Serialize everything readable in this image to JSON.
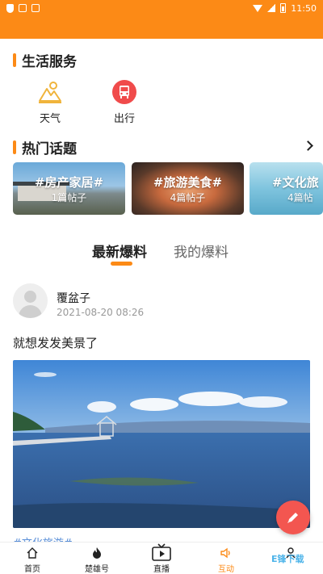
{
  "status_bar": {
    "time": "11:50"
  },
  "life_services": {
    "title": "生活服务",
    "items": [
      {
        "label": "天气",
        "icon": "weather-mountain-icon"
      },
      {
        "label": "出行",
        "icon": "bus-icon"
      }
    ]
  },
  "hot_topics": {
    "title": "热门话题",
    "cards": [
      {
        "title": "#房产家居#",
        "count": "1篇帖子"
      },
      {
        "title": "#旅游美食#",
        "count": "4篇帖子"
      },
      {
        "title": "#文化旅",
        "count": "4篇帖"
      }
    ]
  },
  "tabs": [
    {
      "label": "最新爆料",
      "active": true
    },
    {
      "label": "我的爆料",
      "active": false
    }
  ],
  "post": {
    "author": "覆盆子",
    "time": "2021-08-20 08:26",
    "content": "就想发发美景了",
    "hashtag": "#文化旅游#"
  },
  "bottom_nav": [
    {
      "label": "首页",
      "icon": "home-icon",
      "active": false
    },
    {
      "label": "楚雄号",
      "icon": "flame-icon",
      "active": false
    },
    {
      "label": "直播",
      "icon": "tv-play-icon",
      "active": false
    },
    {
      "label": "互动",
      "icon": "speaker-icon",
      "active": true
    },
    {
      "label": "",
      "icon": "user-icon",
      "active": false
    }
  ],
  "watermark": "E锋下载",
  "colors": {
    "accent": "#fc8a16",
    "fab": "#f35650",
    "hashtag": "#5a8fd8"
  }
}
